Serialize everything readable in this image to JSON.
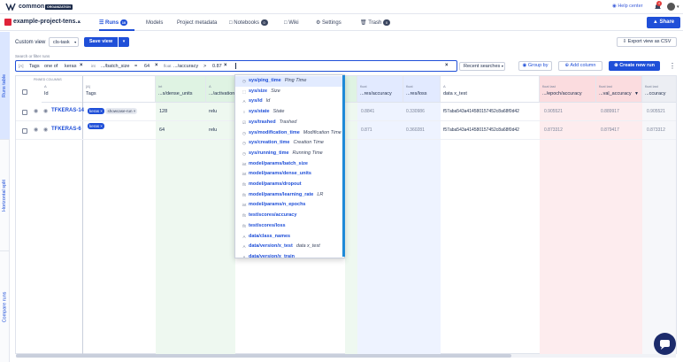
{
  "topbar": {
    "brand": "common",
    "org_badge": "ORGANIZATION",
    "help_label": "Help center",
    "notification_count": "4"
  },
  "project": {
    "name": "example-project-tens...",
    "tabs": [
      {
        "label": "Runs",
        "badge": "10",
        "active": true
      },
      {
        "label": "Models"
      },
      {
        "label": "Project metadata"
      },
      {
        "label": "Notebooks",
        "badge": "0"
      },
      {
        "label": "Wiki"
      },
      {
        "label": "Settings"
      },
      {
        "label": "Trash",
        "badge": "0"
      }
    ],
    "share_label": "Share"
  },
  "rail": [
    "Runs table",
    "Horizontal split",
    "Compare runs"
  ],
  "view": {
    "label": "Custom view",
    "selected": "cls-task",
    "save_label": "Save view",
    "export_label": "Export view as CSV"
  },
  "search": {
    "label": "Search or filter runs",
    "chips": [
      {
        "type": "[A]",
        "field": "Tags",
        "op": "one of",
        "value": "keras"
      },
      {
        "type": "int",
        "field": ".../batch_size",
        "op": "=",
        "value": "64"
      },
      {
        "type": "float",
        "field": ".../accuracy",
        "op": ">",
        "value": "0.87"
      }
    ],
    "recent_label": "Recent searches",
    "group_by_label": "Group by",
    "add_column_label": "Add column",
    "new_run_label": "Create new run"
  },
  "table": {
    "pinned_label": "PINNED COLUMNS",
    "columns": [
      {
        "type": "A",
        "name": "Id"
      },
      {
        "type": "[A]",
        "name": "Tags"
      },
      {
        "type": "int",
        "name": "...s/dense_units"
      },
      {
        "type": "A",
        "name": ".../activation"
      },
      {
        "type": "float",
        "name": "...res/accuracy"
      },
      {
        "type": "float",
        "name": "...res/loss"
      },
      {
        "type": "A",
        "name": "data x_test"
      },
      {
        "type": "float last",
        "name": ".../epoch/accuracy"
      },
      {
        "type": "float last",
        "name": "...val_accuracy"
      },
      {
        "type": "float last",
        "name": "...ccuracy"
      }
    ],
    "rows": [
      {
        "id": "TFKERAS-14",
        "tags": [
          "keras",
          "showcase-run"
        ],
        "dense_units": "128",
        "activation": "relu",
        "accuracy": "0.8841",
        "loss": "0.330986",
        "x_test": "f57aba543a414580157452c8a68f0d42",
        "epoch_acc": "0.905521",
        "val_acc": "0.889917",
        "acc": "0.905521"
      },
      {
        "id": "TFKERAS-6",
        "tags": [
          "keras"
        ],
        "dense_units": "64",
        "activation": "relu",
        "accuracy": "0.871",
        "loss": "0.360281",
        "x_test": "f57aba543a414580157452c8a68f0d42",
        "epoch_acc": "0.873312",
        "val_acc": "0.879417",
        "acc": "0.873312"
      }
    ]
  },
  "dropdown": [
    {
      "icon": "clock",
      "name": "sys/ping_time",
      "alias": "Ping Time",
      "selected": true
    },
    {
      "icon": "size",
      "name": "sys/size",
      "alias": "Size"
    },
    {
      "icon": "A",
      "name": "sys/id",
      "alias": "Id"
    },
    {
      "icon": "circle",
      "name": "sys/state",
      "alias": "State"
    },
    {
      "icon": "check",
      "name": "sys/trashed",
      "alias": "Trashed"
    },
    {
      "icon": "clock",
      "name": "sys/modification_time",
      "alias": "Modification Time"
    },
    {
      "icon": "clock",
      "name": "sys/creation_time",
      "alias": "Creation Time"
    },
    {
      "icon": "clock",
      "name": "sys/running_time",
      "alias": "Running Time"
    },
    {
      "icon": "int",
      "name": "model/params/batch_size",
      "alias": ""
    },
    {
      "icon": "int",
      "name": "model/params/dense_units",
      "alias": ""
    },
    {
      "icon": "float",
      "name": "model/params/dropout",
      "alias": ""
    },
    {
      "icon": "float",
      "name": "model/params/learning_rate",
      "alias": "LR"
    },
    {
      "icon": "int",
      "name": "model/params/n_epochs",
      "alias": ""
    },
    {
      "icon": "float",
      "name": "test/scores/accuracy",
      "alias": ""
    },
    {
      "icon": "float",
      "name": "test/scores/loss",
      "alias": ""
    },
    {
      "icon": "A",
      "name": "data/class_names",
      "alias": ""
    },
    {
      "icon": "A",
      "name": "data/version/x_test",
      "alias": "data x_test"
    },
    {
      "icon": "A",
      "name": "data/version/x_train",
      "alias": ""
    }
  ],
  "colors": {
    "accent": "#1f4fd8",
    "brand_red": "#e0243a",
    "green_col": "#e7f6ea",
    "red_col": "#fde8ea"
  }
}
